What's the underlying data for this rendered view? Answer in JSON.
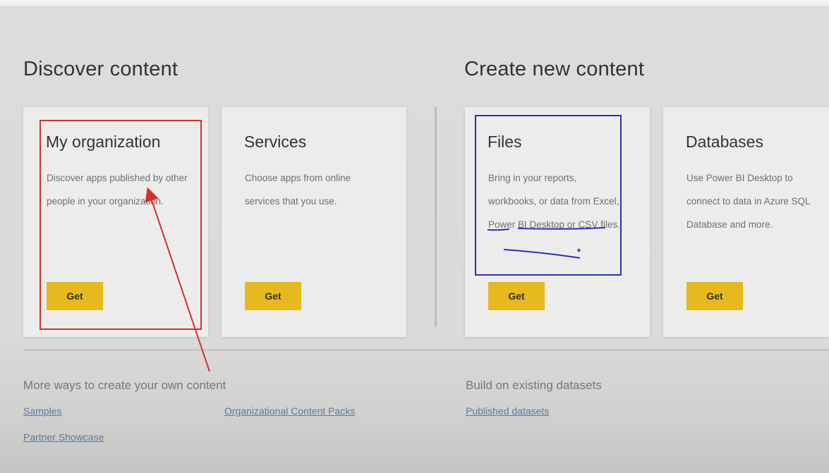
{
  "discover": {
    "title": "Discover content",
    "cards": [
      {
        "title": "My organization",
        "description": "Discover apps published by other people in your organization.",
        "button": "Get"
      },
      {
        "title": "Services",
        "description": "Choose apps from online services that you use.",
        "button": "Get"
      }
    ]
  },
  "create": {
    "title": "Create new content",
    "cards": [
      {
        "title": "Files",
        "description_parts": {
          "lead": "Bring in your reports, workbooks, or data from",
          "excel": "Excel",
          "sep": ", ",
          "pbi": "Power BI Desktop",
          "or": " or ",
          "csv": "CSV files."
        },
        "button": "Get"
      },
      {
        "title": "Databases",
        "description": "Use Power BI Desktop to connect to data in Azure SQL Database and more.",
        "button": "Get"
      }
    ]
  },
  "more": {
    "title": "More ways to create your own content",
    "links": {
      "samples": "Samples",
      "org_content_packs": "Organizational Content Packs",
      "partner_showcase": "Partner Showcase"
    }
  },
  "build": {
    "title": "Build on existing datasets",
    "links": {
      "published_datasets": "Published datasets"
    }
  },
  "annotations": {
    "red": "#d4302b",
    "blue": "#2c2fb8"
  },
  "colors": {
    "accent": "#e6b91e",
    "link": "#5b7aa3"
  }
}
